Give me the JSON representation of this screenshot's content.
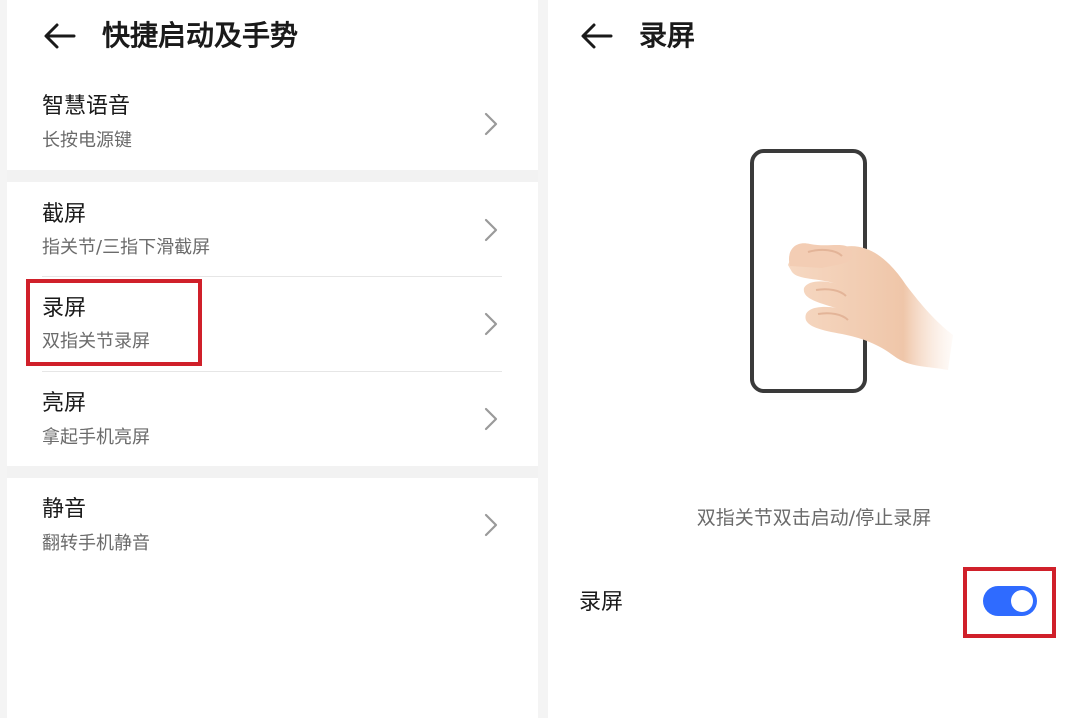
{
  "left_panel": {
    "title": "快捷启动及手势",
    "items": [
      {
        "title": "智慧语音",
        "subtitle": "长按电源键"
      },
      {
        "title": "截屏",
        "subtitle": "指关节/三指下滑截屏"
      },
      {
        "title": "录屏",
        "subtitle": "双指关节录屏"
      },
      {
        "title": "亮屏",
        "subtitle": "拿起手机亮屏"
      },
      {
        "title": "静音",
        "subtitle": "翻转手机静音"
      }
    ]
  },
  "right_panel": {
    "title": "录屏",
    "caption": "双指关节双击启动/停止录屏",
    "toggle_label": "录屏",
    "toggle_on": true
  },
  "icons": {
    "back": "back-arrow-icon",
    "chevron": "chevron-right-icon"
  },
  "colors": {
    "accent": "#2f6bff",
    "highlight": "#d0202a"
  }
}
